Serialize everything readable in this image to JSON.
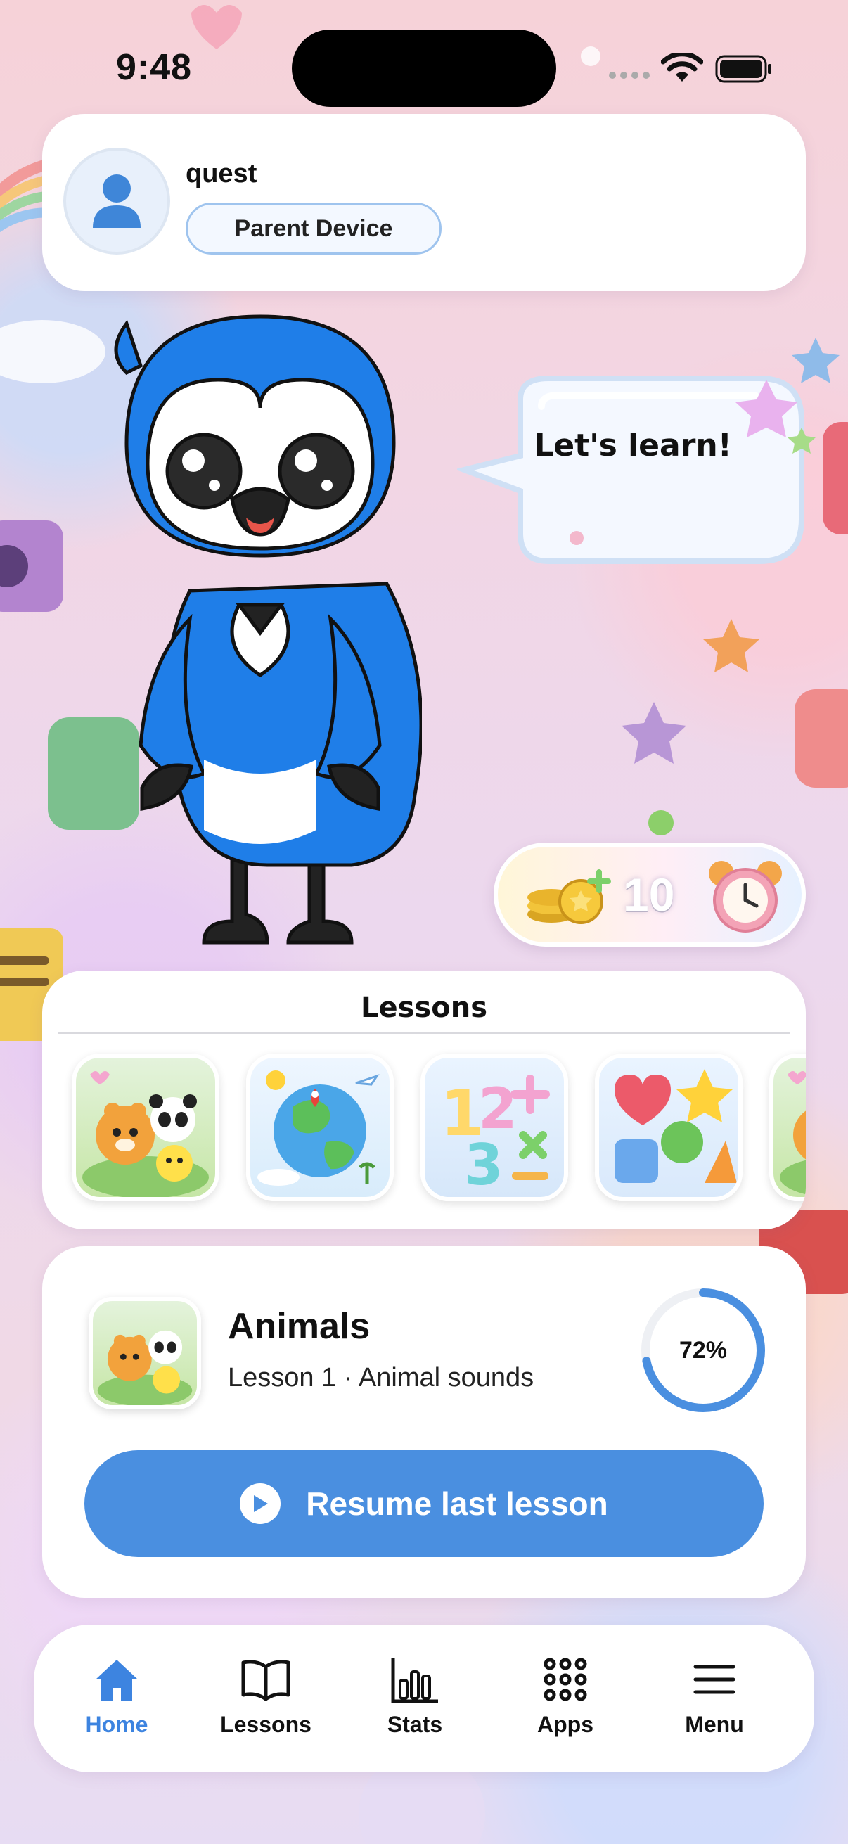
{
  "status_bar": {
    "time": "9:48"
  },
  "profile": {
    "name": "quest",
    "device_label": "Parent Device"
  },
  "mascot": {
    "speech": "Let's learn!"
  },
  "rewards": {
    "coins": "10"
  },
  "lessons": {
    "title": "Lessons",
    "items": [
      {
        "name": "animals-lesson-tile",
        "icon": "animals-icon"
      },
      {
        "name": "geography-lesson-tile",
        "icon": "globe-icon"
      },
      {
        "name": "numbers-lesson-tile",
        "icon": "numbers-icon"
      },
      {
        "name": "shapes-lesson-tile",
        "icon": "shapes-icon"
      },
      {
        "name": "animals-lesson-tile-2",
        "icon": "animals-icon"
      }
    ]
  },
  "resume": {
    "title": "Animals",
    "subtitle": "Lesson 1 · Animal sounds",
    "progress_percent": 72,
    "progress_label": "72%",
    "button_label": "Resume last lesson"
  },
  "tabs": [
    {
      "label": "Home",
      "icon": "home-icon",
      "active": true
    },
    {
      "label": "Lessons",
      "icon": "book-icon",
      "active": false
    },
    {
      "label": "Stats",
      "icon": "bar-chart-icon",
      "active": false
    },
    {
      "label": "Apps",
      "icon": "grid-dots-icon",
      "active": false
    },
    {
      "label": "Menu",
      "icon": "hamburger-menu-icon",
      "active": false
    }
  ],
  "colors": {
    "accent": "#4a8fe0",
    "active_tab": "#3d84e0"
  }
}
